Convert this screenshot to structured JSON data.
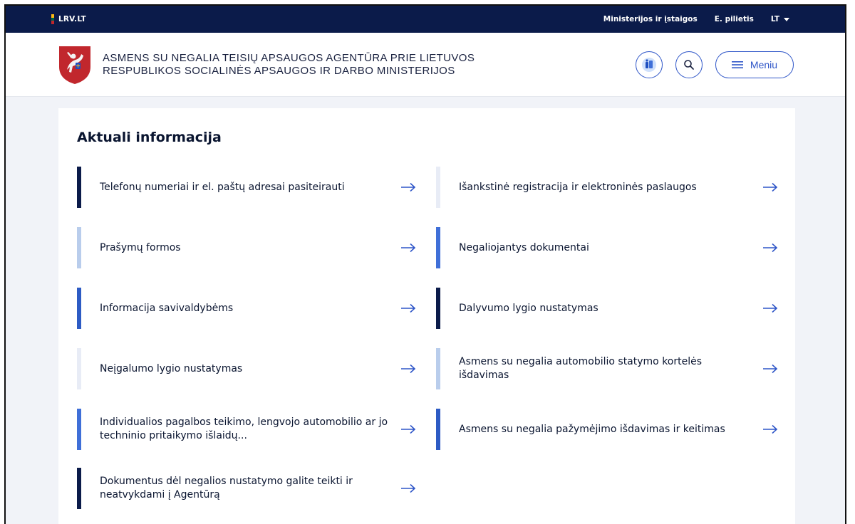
{
  "topbar": {
    "brand": "LRV.LT",
    "nav": [
      "Ministerijos ir įstaigos",
      "E. pilietis"
    ],
    "lang": "LT",
    "flag_colors": [
      "#fdb913",
      "#006a44",
      "#c1272d"
    ]
  },
  "header": {
    "agency_line1": "ASMENS SU NEGALIA TEISIŲ APSAUGOS AGENTŪRA PRIE LIETUVOS",
    "agency_line2": "RESPUBLIKOS SOCIALINĖS APSAUGOS IR DARBO MINISTERIJOS",
    "crest_icon": "vytis-crest-icon",
    "menu_label": "Meniu"
  },
  "main": {
    "title": "Aktuali informacija",
    "links": [
      {
        "label": "Telefonų numeriai ir el. paštų adresai pasiteirauti",
        "bar_color": "#0b1b4a"
      },
      {
        "label": "Išankstinė registracija ir elektroninės paslaugos",
        "bar_color": "#e8ecf6"
      },
      {
        "label": "Prašymų formos",
        "bar_color": "#b9cdec"
      },
      {
        "label": "Negaliojantys dokumentai",
        "bar_color": "#3f6fd8"
      },
      {
        "label": "Informacija savivaldybėms",
        "bar_color": "#2d5bc4"
      },
      {
        "label": "Dalyvumo lygio nustatymas",
        "bar_color": "#0b1b4a"
      },
      {
        "label": "Neįgalumo lygio nustatymas",
        "bar_color": "#e8ecf6"
      },
      {
        "label": "Asmens su negalia automobilio statymo kortelės išdavimas",
        "bar_color": "#b9cdec"
      },
      {
        "label": "Individualios pagalbos teikimo, lengvojo automobilio ar jo techninio pritaikymo išlaidų...",
        "bar_color": "#3f6fd8"
      },
      {
        "label": "Asmens su negalia pažymėjimo išdavimas ir keitimas",
        "bar_color": "#2d5bc4"
      },
      {
        "label": "Dokumentus dėl negalios nustatymo galite teikti ir neatvykdami į Agentūrą",
        "bar_color": "#0b1b4a"
      }
    ]
  },
  "colors": {
    "navy": "#0b1b4a",
    "accent": "#2f56c8",
    "page_bg": "#f1f3f8"
  }
}
